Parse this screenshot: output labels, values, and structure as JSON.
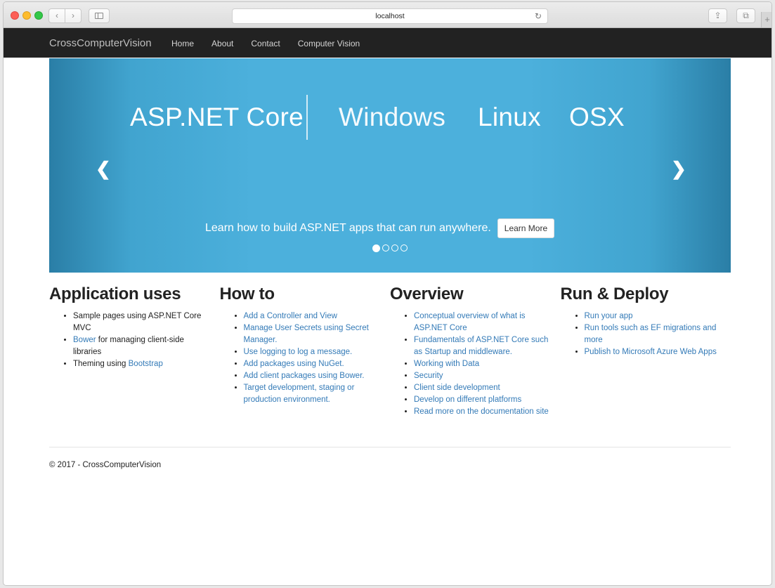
{
  "browser": {
    "address": "localhost",
    "reload_icon": "reload-icon",
    "back_icon": "chevron-left-icon",
    "forward_icon": "chevron-right-icon"
  },
  "navbar": {
    "brand": "CrossComputerVision",
    "links": [
      "Home",
      "About",
      "Contact",
      "Computer Vision"
    ]
  },
  "carousel": {
    "words": [
      "ASP.NET Core",
      "Windows",
      "Linux",
      "OSX"
    ],
    "caption": "Learn how to build ASP.NET apps that can run anywhere.",
    "button": "Learn More",
    "slide_count": 4,
    "active_slide": 1,
    "colors": {
      "background": "#4cb0dc",
      "edge": "#2a7ea6"
    }
  },
  "columns": [
    {
      "title": "Application uses",
      "items": [
        [
          {
            "text": "Sample pages using ASP.NET Core MVC",
            "link": false
          }
        ],
        [
          {
            "text": "Bower",
            "link": true
          },
          {
            "text": " for managing client-side libraries",
            "link": false
          }
        ],
        [
          {
            "text": "Theming using ",
            "link": false
          },
          {
            "text": "Bootstrap",
            "link": true
          }
        ]
      ]
    },
    {
      "title": "How to",
      "items": [
        [
          {
            "text": "Add a Controller and View",
            "link": true
          }
        ],
        [
          {
            "text": "Manage User Secrets using Secret Manager.",
            "link": true
          }
        ],
        [
          {
            "text": "Use logging to log a message.",
            "link": true
          }
        ],
        [
          {
            "text": "Add packages using NuGet.",
            "link": true
          }
        ],
        [
          {
            "text": "Add client packages using Bower.",
            "link": true
          }
        ],
        [
          {
            "text": "Target development, staging or production environment.",
            "link": true
          }
        ]
      ]
    },
    {
      "title": "Overview",
      "items": [
        [
          {
            "text": "Conceptual overview of what is ASP.NET Core",
            "link": true
          }
        ],
        [
          {
            "text": "Fundamentals of ASP.NET Core such as Startup and middleware.",
            "link": true
          }
        ],
        [
          {
            "text": "Working with Data",
            "link": true
          }
        ],
        [
          {
            "text": "Security",
            "link": true
          }
        ],
        [
          {
            "text": "Client side development",
            "link": true
          }
        ],
        [
          {
            "text": "Develop on different platforms",
            "link": true
          }
        ],
        [
          {
            "text": "Read more on the documentation site",
            "link": true
          }
        ]
      ]
    },
    {
      "title": "Run & Deploy",
      "items": [
        [
          {
            "text": "Run your app",
            "link": true
          }
        ],
        [
          {
            "text": "Run tools such as EF migrations and more",
            "link": true
          }
        ],
        [
          {
            "text": "Publish to Microsoft Azure Web Apps",
            "link": true
          }
        ]
      ]
    }
  ],
  "footer": "© 2017 - CrossComputerVision",
  "colors": {
    "link": "#337ab7",
    "navbar": "#222222"
  }
}
